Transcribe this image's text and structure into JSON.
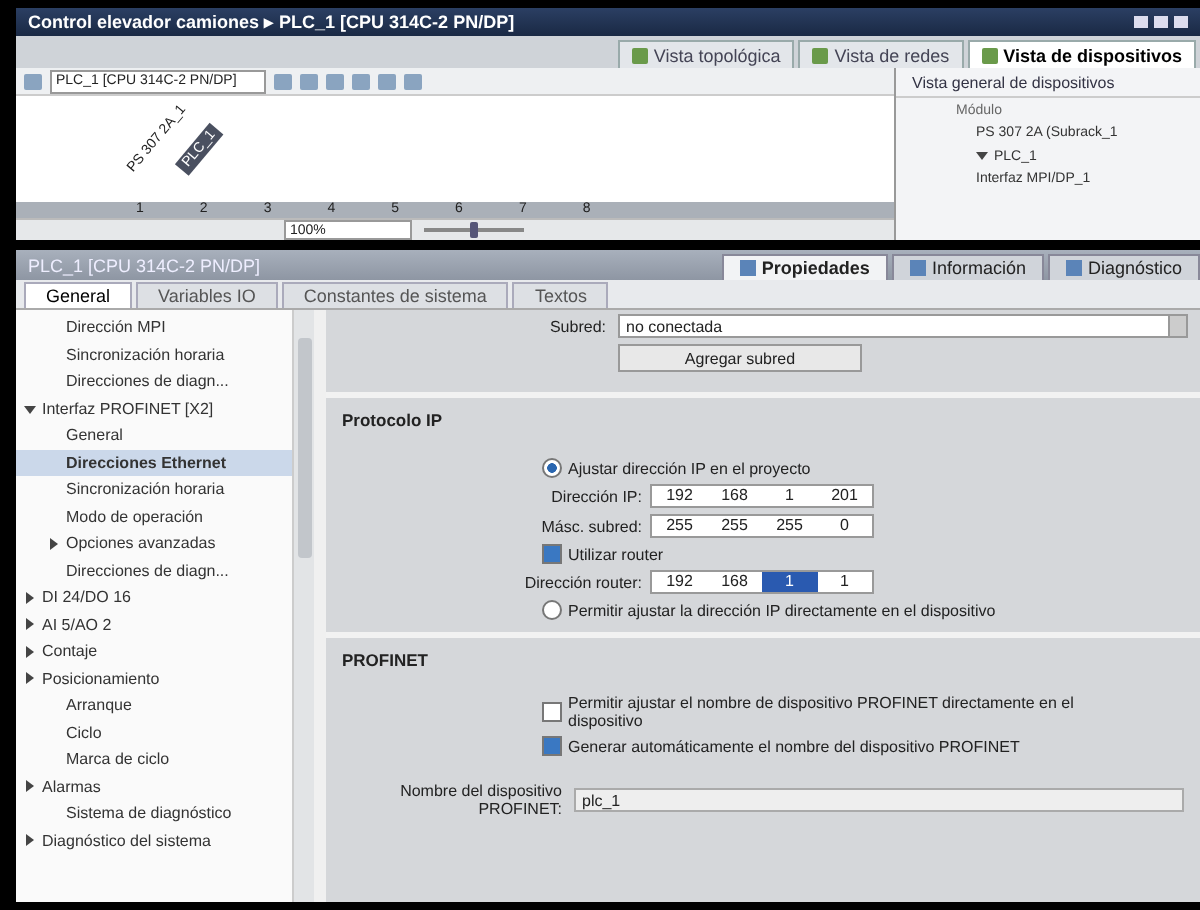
{
  "window": {
    "title": "Control elevador camiones ▸ PLC_1 [CPU 314C-2 PN/DP]"
  },
  "view_tabs": [
    {
      "label": "Vista topológica",
      "selected": false
    },
    {
      "label": "Vista de redes",
      "selected": false
    },
    {
      "label": "Vista de dispositivos",
      "selected": true
    }
  ],
  "device_toolbar": {
    "device": "PLC_1 [CPU 314C-2 PN/DP]"
  },
  "canvas": {
    "modules": [
      {
        "label": "PS 307 2A_1",
        "kind": "plain"
      },
      {
        "label": "PLC_1",
        "kind": "dark"
      }
    ],
    "slots": [
      "1",
      "2",
      "3",
      "4",
      "5",
      "6",
      "7",
      "8"
    ],
    "zoom": "100%",
    "zoom_slider": {
      "level": 0.5
    }
  },
  "overview": {
    "title": "Vista general de dispositivos",
    "column": "Módulo",
    "rows": [
      {
        "label": "PS 307 2A (Subrack_1"
      },
      {
        "label": "PLC_1",
        "expanded": true
      },
      {
        "label": "Interfaz MPI/DP_1"
      }
    ]
  },
  "properties": {
    "title": "PLC_1 [CPU 314C-2 PN/DP]",
    "tabs": [
      {
        "label": "Propiedades",
        "selected": true
      },
      {
        "label": "Información",
        "selected": false
      },
      {
        "label": "Diagnóstico",
        "selected": false
      }
    ],
    "subtabs": [
      {
        "label": "General",
        "selected": true
      },
      {
        "label": "Variables IO",
        "selected": false
      },
      {
        "label": "Constantes de sistema",
        "selected": false
      },
      {
        "label": "Textos",
        "selected": false
      }
    ]
  },
  "tree": [
    {
      "label": "Dirección MPI",
      "kind": "leaf",
      "selected": false
    },
    {
      "label": "Sincronización horaria",
      "kind": "leaf",
      "selected": false
    },
    {
      "label": "Direcciones de diagn...",
      "kind": "leaf",
      "selected": false
    },
    {
      "label": "Interfaz PROFINET [X2]",
      "kind": "group",
      "expanded": true,
      "selected": false,
      "children": [
        {
          "label": "General",
          "kind": "leaf",
          "selected": false
        },
        {
          "label": "Direcciones Ethernet",
          "kind": "leaf",
          "selected": true
        },
        {
          "label": "Sincronización horaria",
          "kind": "leaf",
          "selected": false
        },
        {
          "label": "Modo de operación",
          "kind": "leaf",
          "selected": false
        },
        {
          "label": "Opciones avanzadas",
          "kind": "group",
          "expanded": false,
          "selected": false
        },
        {
          "label": "Direcciones de diagn...",
          "kind": "leaf",
          "selected": false
        }
      ]
    },
    {
      "label": "DI 24/DO 16",
      "kind": "group",
      "expanded": false,
      "selected": false
    },
    {
      "label": "AI 5/AO 2",
      "kind": "group",
      "expanded": false,
      "selected": false
    },
    {
      "label": "Contaje",
      "kind": "group",
      "expanded": false,
      "selected": false
    },
    {
      "label": "Posicionamiento",
      "kind": "group",
      "expanded": false,
      "selected": false
    },
    {
      "label": "Arranque",
      "kind": "leaf",
      "selected": false
    },
    {
      "label": "Ciclo",
      "kind": "leaf",
      "selected": false
    },
    {
      "label": "Marca de ciclo",
      "kind": "leaf",
      "selected": false
    },
    {
      "label": "Alarmas",
      "kind": "group",
      "expanded": false,
      "selected": false
    },
    {
      "label": "Sistema de diagnóstico",
      "kind": "leaf",
      "selected": false
    },
    {
      "label": "Diagnóstico del sistema",
      "kind": "group",
      "expanded": false,
      "selected": false
    }
  ],
  "subnet": {
    "label": "Subred:",
    "value": "no conectada",
    "button": "Agregar subred"
  },
  "ip_protocol": {
    "title": "Protocolo IP",
    "set_in_project": {
      "label": "Ajustar dirección IP en el proyecto",
      "selected": true
    },
    "ip": {
      "label": "Dirección IP:",
      "octets": [
        {
          "text": "192",
          "selected": false
        },
        {
          "text": "168",
          "selected": false
        },
        {
          "text": "1",
          "selected": false
        },
        {
          "text": "201",
          "selected": false
        }
      ]
    },
    "mask": {
      "label": "Másc. subred:",
      "octets": [
        {
          "text": "255",
          "selected": false
        },
        {
          "text": "255",
          "selected": false
        },
        {
          "text": "255",
          "selected": false
        },
        {
          "text": "0",
          "selected": false
        }
      ]
    },
    "use_router": {
      "label": "Utilizar router",
      "checked": true
    },
    "router": {
      "label": "Dirección router:",
      "octets": [
        {
          "text": "192",
          "selected": false
        },
        {
          "text": "168",
          "selected": false
        },
        {
          "text": "1",
          "selected": true
        },
        {
          "text": "1",
          "selected": false
        }
      ]
    },
    "set_on_device": {
      "label": "Permitir ajustar la dirección IP directamente en el dispositivo",
      "selected": false
    }
  },
  "profinet": {
    "title": "PROFINET",
    "options": [
      {
        "label": "Permitir ajustar el nombre de dispositivo PROFINET directamente en el dispositivo",
        "checked": false
      },
      {
        "label": "Generar automáticamente el nombre del dispositivo PROFINET",
        "checked": true
      }
    ],
    "name": {
      "label": "Nombre del dispositivo PROFINET:",
      "value": "plc_1"
    }
  }
}
